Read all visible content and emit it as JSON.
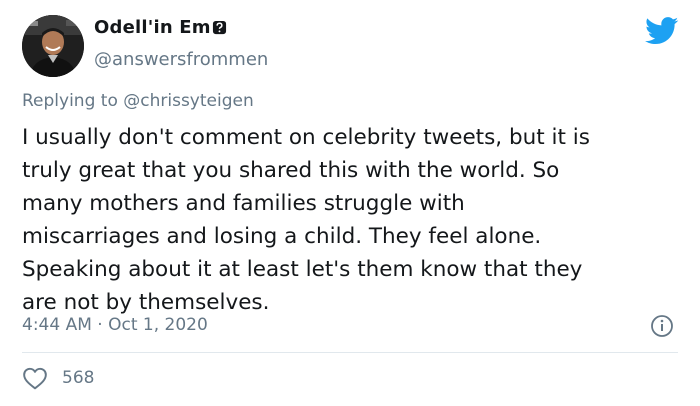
{
  "author": {
    "display_name": "Odell'in Em",
    "handle": "@answersfrommen"
  },
  "reply": {
    "prefix": "Replying to",
    "mention": "@chrissyteigen"
  },
  "tweet": {
    "lines": [
      "I usually don't comment on celebrity tweets, but it is",
      "truly great that you shared this with the world. So",
      "many mothers and families struggle with",
      "miscarriages and losing a child. They feel alone.",
      "Speaking about it at least let's them know that they",
      "are not by themselves."
    ],
    "time": "4:44 AM",
    "separator": "·",
    "date": "Oct 1, 2020"
  },
  "engagement": {
    "likes": "568"
  },
  "icons": {
    "brand": "twitter-bird-icon",
    "info": "info-icon",
    "like": "heart-icon",
    "emoji": "question-emoji-icon"
  },
  "colors": {
    "twitter_blue": "#1da1f2",
    "text_primary": "#14171a",
    "text_secondary": "#657786",
    "divider": "#e1e8ed"
  }
}
